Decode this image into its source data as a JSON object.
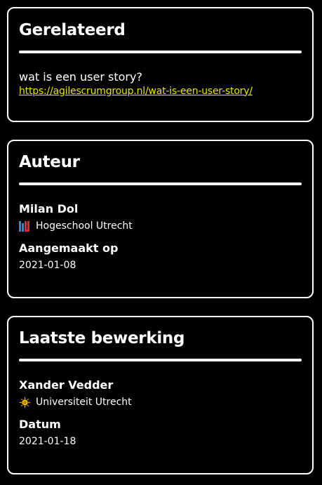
{
  "related": {
    "title": "Gerelateerd",
    "item_title": "wat is een user story?",
    "item_url": "https://agilescrumgroup.nl/wat-is-een-user-story/"
  },
  "author": {
    "title": "Auteur",
    "name": "Milan Dol",
    "organisation": "Hogeschool Utrecht",
    "organisation_logo": "hu-logo",
    "created_label": "Aangemaakt op",
    "created_value": "2021-01-08"
  },
  "last_edit": {
    "title": "Laatste bewerking",
    "name": "Xander Vedder",
    "organisation": "Universiteit Utrecht",
    "organisation_logo": "uu-sun-logo",
    "date_label": "Datum",
    "date_value": "2021-01-18"
  },
  "colors": {
    "background": "#000000",
    "text": "#ffffff",
    "link": "#e6e600",
    "hu_blue": "#1f8fd6",
    "hu_red": "#e3262f",
    "uu_gold": "#f0b400"
  }
}
